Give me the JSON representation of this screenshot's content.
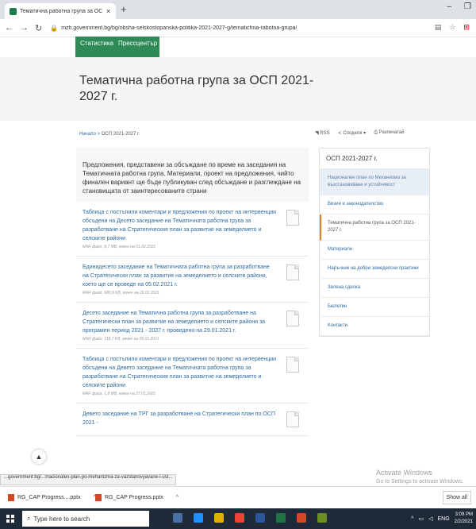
{
  "browser": {
    "tab_title": "Тематична работна група за ОС",
    "url": "mzh.government.bg/bg/obsha-selskostopanska-politika-2021-2027-g/tematichna-rabotna-grupa/"
  },
  "site": {
    "top_links": [
      "Статистика",
      "Прессцентър"
    ],
    "page_title": "Тематична работна група за ОСП 2021-2027 г.",
    "breadcrumb": {
      "home": "Начало",
      "separator": ">",
      "current": "ОСП 2021-2027 г."
    },
    "tools": {
      "rss": "RSS",
      "share": "Споделя",
      "print": "Разпечатай"
    }
  },
  "main": {
    "lead": "Предложения, представени за обсъждане по време на заседания на Тематичната работна група. Материали, проект на предложения, чийто финален вариант ще бъде публикуван след обсъждане и разглеждане на становищата от заинтересованите страни",
    "documents": [
      {
        "title": "Таблица с постъпили коментари и предложения по проект на интервенции обсъдени на Десето заседание на Тематичната работна група за разработване на Стратегическия план за развитие на земеделието и селските райони",
        "meta": "RAR файл, 8,7 MB, качен на 01.02.2021"
      },
      {
        "title": "Единадесето заседание на Тематичната работна група за разработване на Стратегически план за развитие на земеделието и селските райони, което ще се проведе на 05.02.2021 г.",
        "meta": "RAR файл, 680,9 KB, качен на 29.01.2021"
      },
      {
        "title": "Десето заседание на Тематична работна група за разработване на Стратегически план за развитие на земеделието и селските райони за програмен период 2021 - 2027 г. проведено на 29.01.2021 г.",
        "meta": "RAR файл, 118,7 KB, качен на 29.01.2021"
      },
      {
        "title": "Таблица с постъпили коментари и предложения по проект на интервенции обсъдени на Девето заседание на Тематичната работна група за разработване на Стратегическия план за развитие на земеделието и селските райони",
        "meta": "RAR файл, 1,8 MB, качен на 27.01.2021"
      },
      {
        "title": "Девето заседание на ТРГ за разработване на Стратегически план по ОСП 2021 -",
        "meta": ""
      }
    ]
  },
  "sidebar": {
    "heading": "ОСП 2021-2027 г.",
    "items": [
      "Национален план по Механизма за възстановяване и устойчивост",
      "Визия и законодателство",
      "Тематична работна група за ОСП 2021-2027 г.",
      "Материали",
      "Наръчник на добри земеделски практики",
      "Зелена сделка",
      "Бюлетин",
      "Контакти"
    ]
  },
  "status": {
    "hover_url": "...government.bg/.../nacionalen-plan-po-mehanizma-za-vazstanovyavane-i-ust...",
    "watermark_title": "Activate Windows",
    "watermark_sub": "Go to Settings to activate Windows."
  },
  "downloads": {
    "items": [
      "RG_CAP Progress....pptx",
      "RG_CAP Progress.pptx"
    ],
    "show_all": "Show all"
  },
  "taskbar": {
    "search_placeholder": "Type here to search",
    "lang": "ENG",
    "time": "3:09 PM",
    "date": "2/2/2021"
  },
  "colors": {
    "brand_green": "#2e8b57",
    "link_blue": "#2c6aa0",
    "accent_orange": "#e67e22"
  }
}
